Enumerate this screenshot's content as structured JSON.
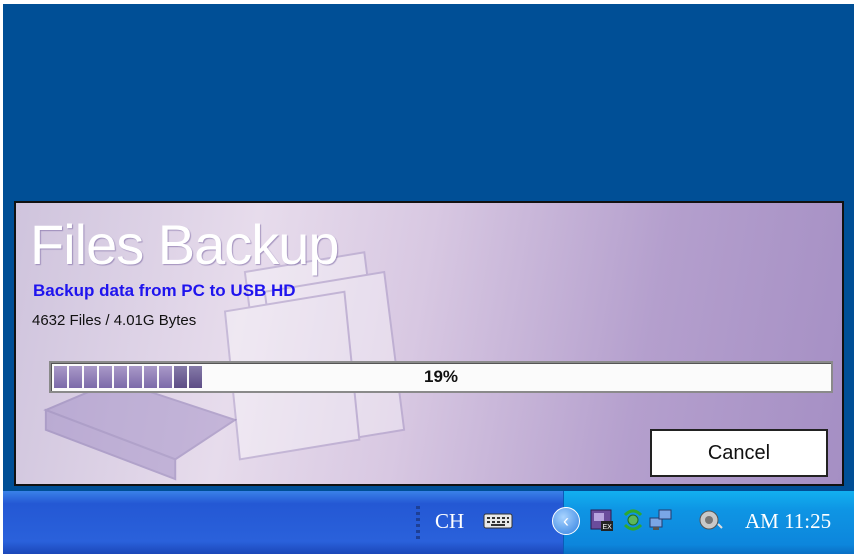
{
  "dialog": {
    "title": "Files Backup",
    "subtitle": "Backup data from PC to USB HD",
    "summary": "4632 Files / 4.01G Bytes",
    "progress": {
      "percent_text": "19%",
      "value": 0.19
    },
    "cancel_label": "Cancel"
  },
  "taskbar": {
    "language": "CH",
    "clock": "AM 11:25",
    "tray_icons": [
      "show-hidden-icons-icon",
      "ex-app-icon",
      "network-refresh-icon",
      "network-computers-icon",
      "audio-speaker-icon"
    ]
  },
  "colors": {
    "desktop": "#004f96",
    "subtitle": "#1f14ee",
    "progress_fill": "#7c6aa9",
    "taskbar": "#2458d4",
    "tray": "#0e95e4"
  }
}
